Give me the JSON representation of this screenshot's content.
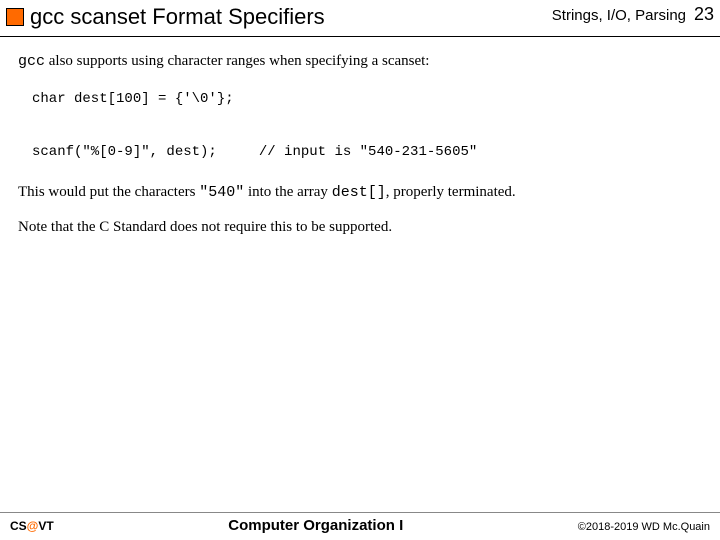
{
  "header": {
    "title": "gcc scanset Format Specifiers",
    "topic": "Strings, I/O, Parsing",
    "page": "23"
  },
  "body": {
    "intro_prefix": "gcc",
    "intro_rest": " also supports using character ranges when specifying a scanset:",
    "code_line1": "char dest[100] = {'\\0'};",
    "code_line2": "scanf(\"%[0-9]\", dest);     // input is \"540-231-5605\"",
    "result_prefix": "This would put the characters ",
    "result_quoted": "\"540\"",
    "result_mid": " into the array ",
    "result_code": "dest[]",
    "result_suffix": ", properly terminated.",
    "note": "Note that the C Standard does not require this to be supported."
  },
  "footer": {
    "left_cs": "CS",
    "left_at": "@",
    "left_vt": "VT",
    "center": "Computer Organization I",
    "right": "©2018-2019 WD Mc.Quain"
  }
}
